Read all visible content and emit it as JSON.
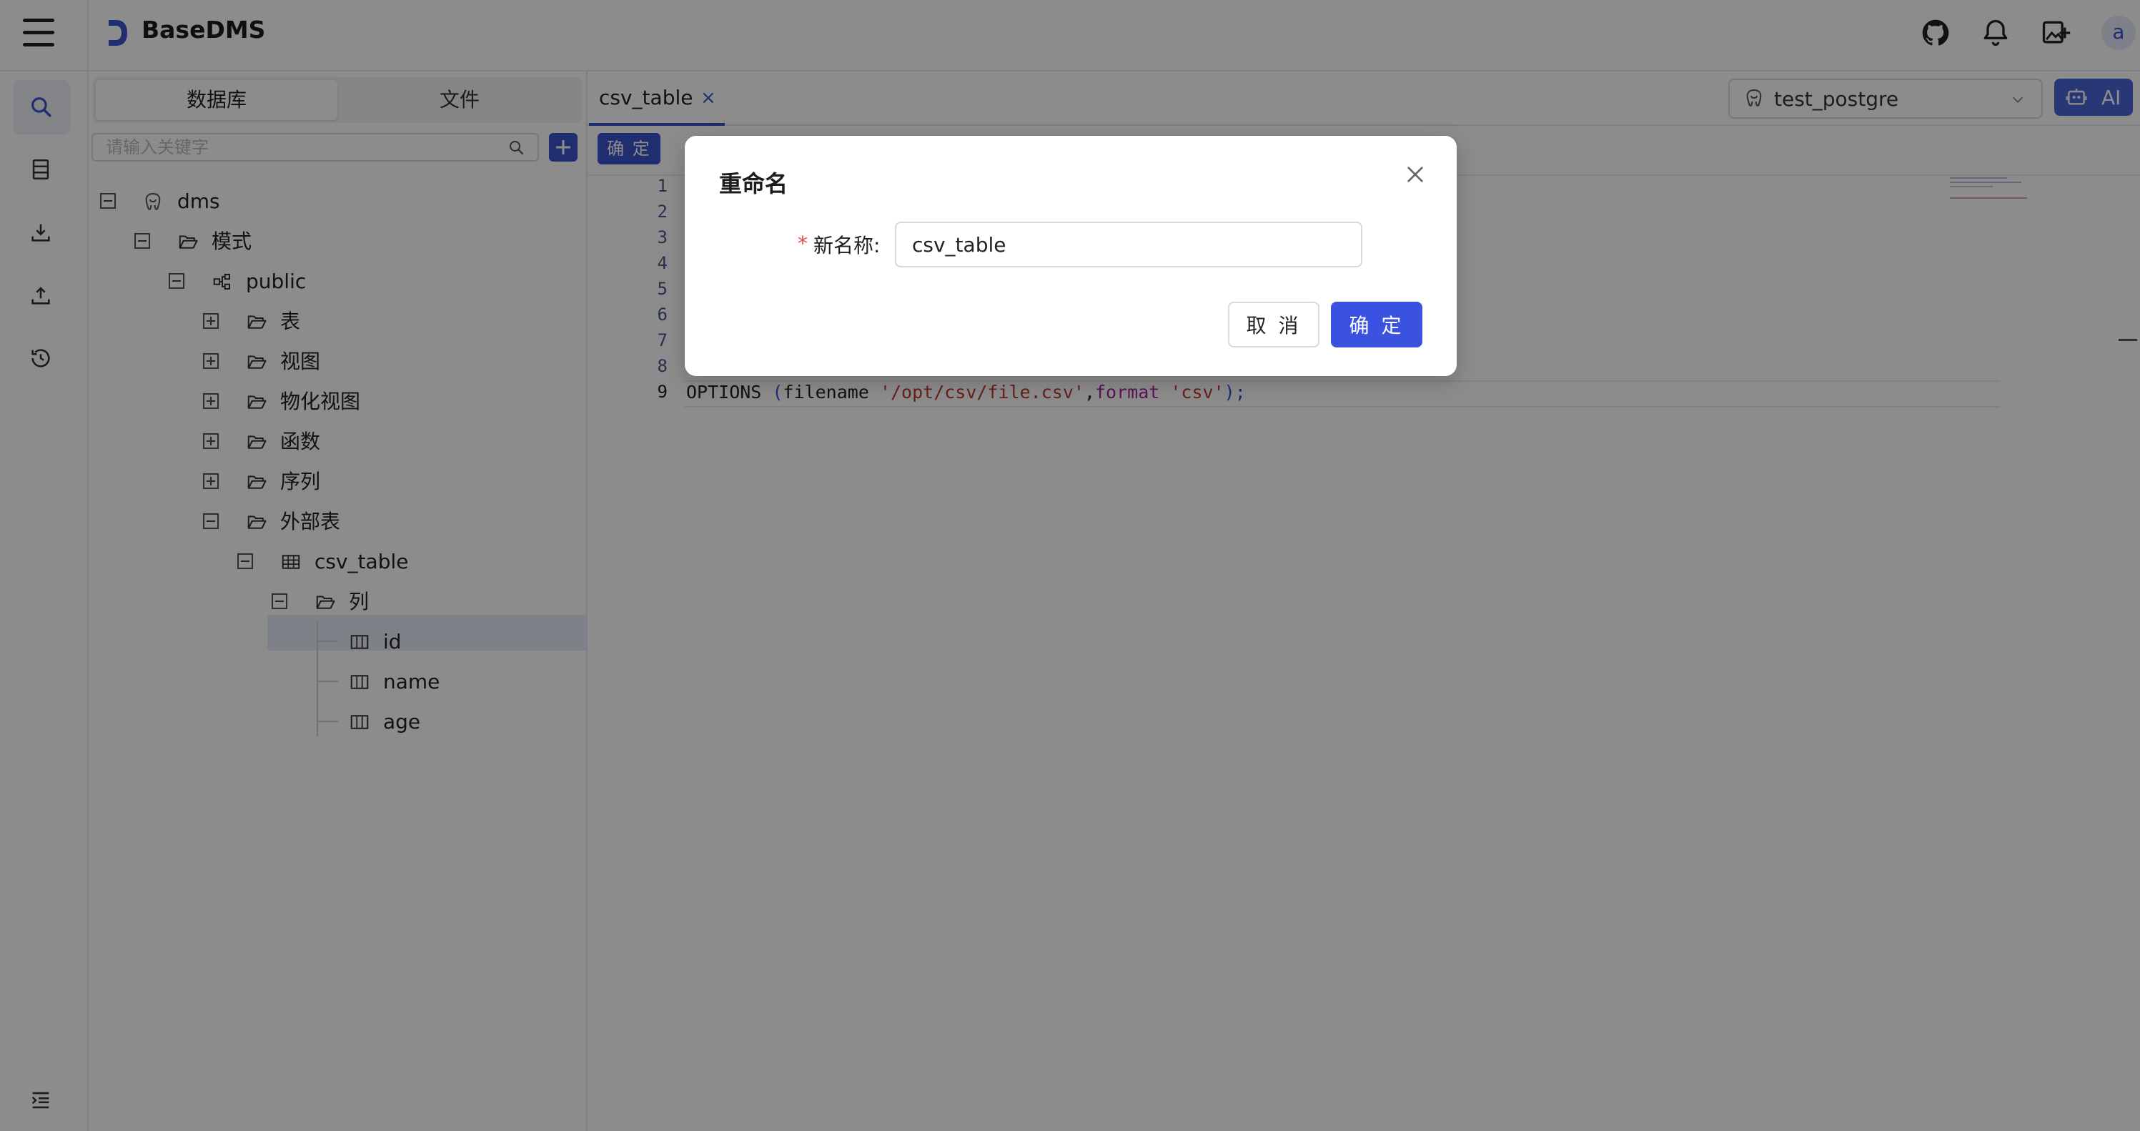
{
  "app": {
    "brand": "BaseDMS",
    "user_initial": "a"
  },
  "header_icons": [
    "github-icon",
    "bell-icon",
    "image-add-icon"
  ],
  "rail": {
    "items": [
      "search-icon",
      "database-icon",
      "download-icon",
      "upload-icon",
      "history-icon"
    ],
    "collapse": "indent-icon"
  },
  "sidebar": {
    "tabs": {
      "database": "数据库",
      "file": "文件"
    },
    "search_placeholder": "请输入关键字",
    "tree": {
      "root": "dms",
      "schema_group": "模式",
      "schema": "public",
      "tables": "表",
      "views": "视图",
      "mat_views": "物化视图",
      "functions": "函数",
      "sequences": "序列",
      "foreign_tables": "外部表",
      "selected_table": "csv_table",
      "columns_group": "列",
      "columns": [
        "id",
        "name",
        "age"
      ]
    }
  },
  "editor": {
    "tab_label": "csv_table",
    "tab_close": "×",
    "connection": "test_postgre",
    "ai_label": "AI",
    "run_label": "确 定",
    "line_numbers": [
      "1",
      "2",
      "3",
      "4",
      "5",
      "6",
      "7",
      "8",
      "9"
    ],
    "code": {
      "kw": "OPTIONS",
      "open": " (",
      "arg1": "filename",
      "str1": "'/opt/csv/file.csv'",
      "comma": ",",
      "kw2": "format",
      "str2": "'csv'",
      "close": ");"
    }
  },
  "modal": {
    "title": "重命名",
    "required_mark": "*",
    "field_label": "新名称:",
    "field_value": "csv_table",
    "cancel": "取 消",
    "ok": "确 定"
  },
  "colors": {
    "accent": "#3b52c8",
    "primary_button": "#3b52e0",
    "selected_row": "#e7ebf7",
    "required": "#e5484d",
    "string": "#c0392b",
    "keyword2": "#a626a4"
  }
}
